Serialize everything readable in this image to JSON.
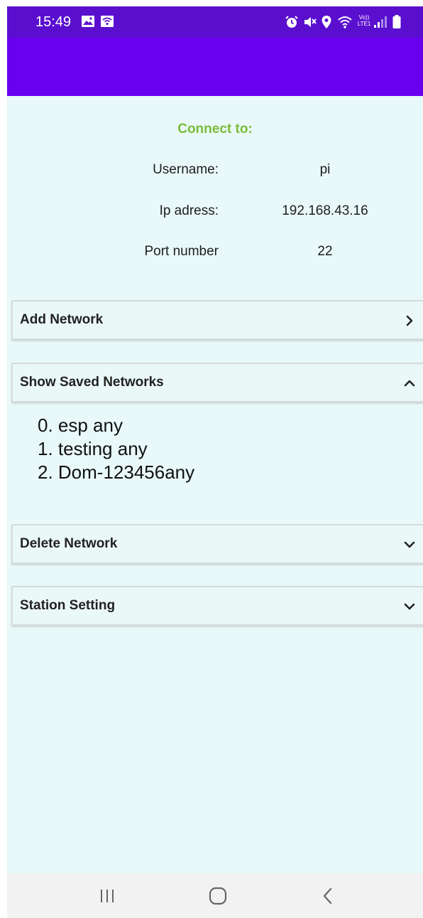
{
  "status_bar": {
    "time": "15:49",
    "left_icons": [
      "gallery-icon",
      "wifi-notification-icon"
    ],
    "right_icons": [
      "alarm-icon",
      "mute-icon",
      "location-icon",
      "wifi-icon",
      "volte-icon",
      "signal-icon",
      "battery-icon"
    ],
    "volte_label": "Vo)) LTE1"
  },
  "colors": {
    "status_bar": "#5a0fcf",
    "app_bar": "#6a00ee",
    "background": "#e9f8f8",
    "accent_green": "#7bbd3b"
  },
  "connection": {
    "title": "Connect to:",
    "rows": [
      {
        "label": "Username:",
        "value": "pi"
      },
      {
        "label": "Ip adress:",
        "value": "192.168.43.16"
      },
      {
        "label": "Port number",
        "value": "22"
      }
    ]
  },
  "sections": [
    {
      "title": "Add Network",
      "icon": "chevron-right-icon",
      "expanded": false
    },
    {
      "title": "Show Saved Networks",
      "icon": "chevron-up-icon",
      "expanded": true
    },
    {
      "title": "Delete Network",
      "icon": "chevron-down-icon",
      "expanded": false
    },
    {
      "title": "Station Setting",
      "icon": "chevron-down-icon",
      "expanded": false
    }
  ],
  "saved_networks": [
    "0. esp any",
    "1. testing any",
    "2. Dom-123456any"
  ],
  "nav_bar": {
    "buttons": [
      "recent-apps-icon",
      "home-icon",
      "back-icon"
    ]
  }
}
